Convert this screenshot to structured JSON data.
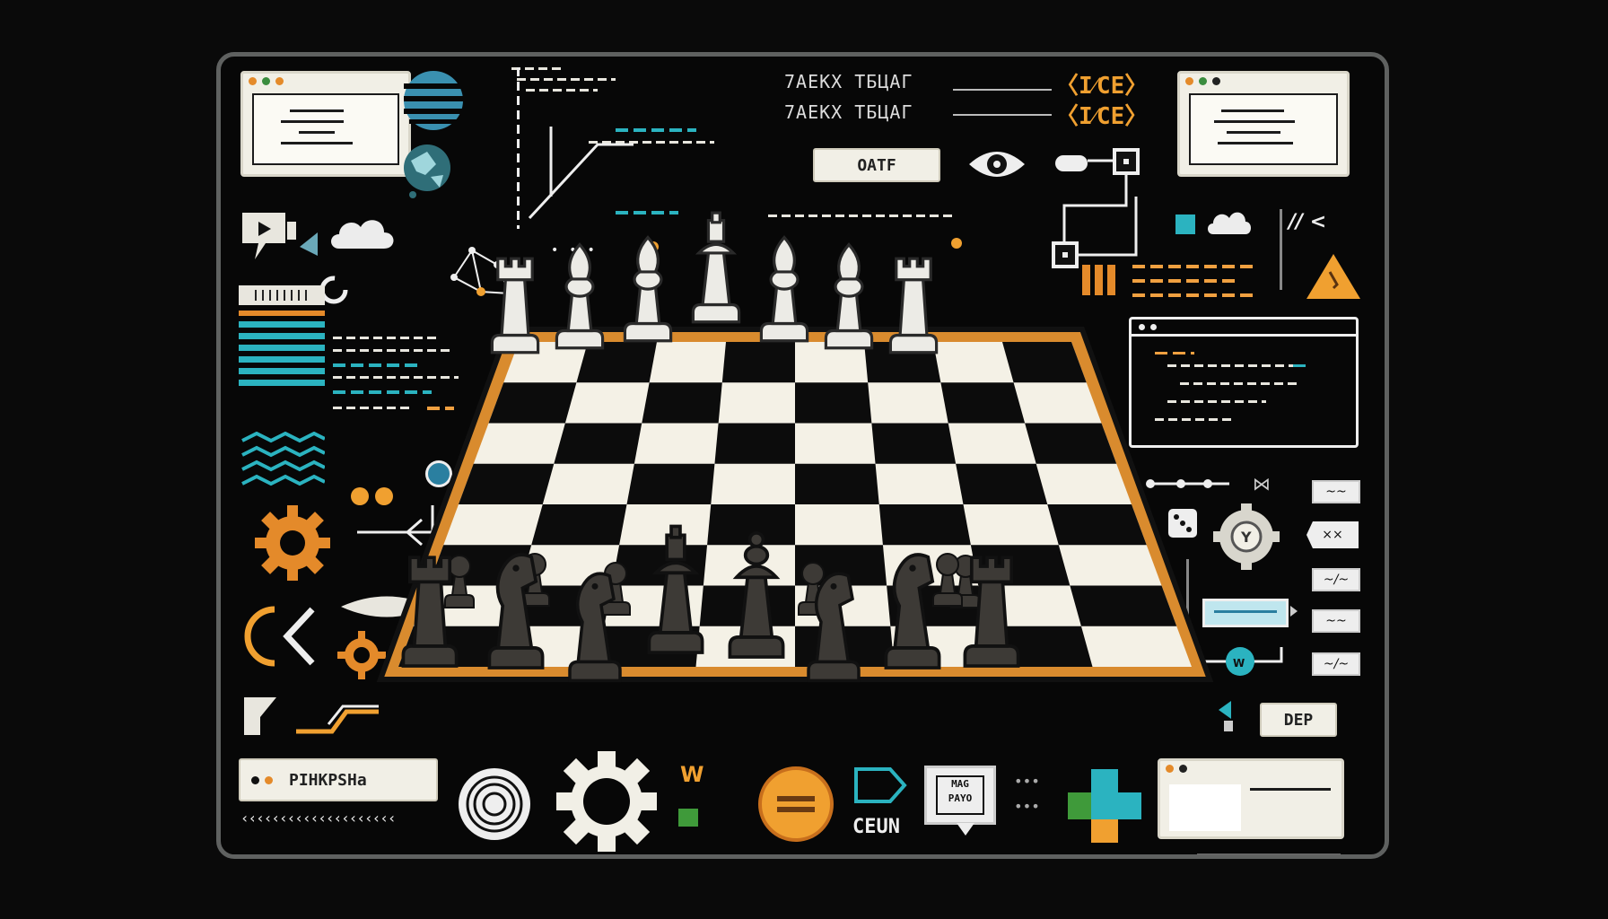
{
  "labels": {
    "top_code_1": "7АЕКХ ТБЦАГ",
    "top_code_2": "7АЕКХ ТБЦАГ",
    "orange_1": "〈I⁄CE〉",
    "orange_2": "〈I⁄CE〉",
    "oatf_button": "OATF",
    "dep_button": "DEP",
    "pinkpsha_field": "PIHKPSHa",
    "cexn_text": "CEUN",
    "speech_box": "MAG\nPAYO",
    "w_label": "W"
  },
  "board": {
    "light_color": "#f4f1e6",
    "dark_color": "#0c0c0c",
    "frame_color": "#d98b2e"
  },
  "pieces": {
    "white": [
      "rook",
      "bishop",
      "bishop",
      "king",
      "bishop",
      "bishop",
      "rook"
    ],
    "black": [
      "rook",
      "knight",
      "knight",
      "king",
      "queen",
      "knight",
      "knight",
      "rook"
    ]
  },
  "colors": {
    "accent_cyan": "#2bb3c0",
    "accent_orange": "#e48a2a",
    "frame_border": "#5f6160"
  }
}
